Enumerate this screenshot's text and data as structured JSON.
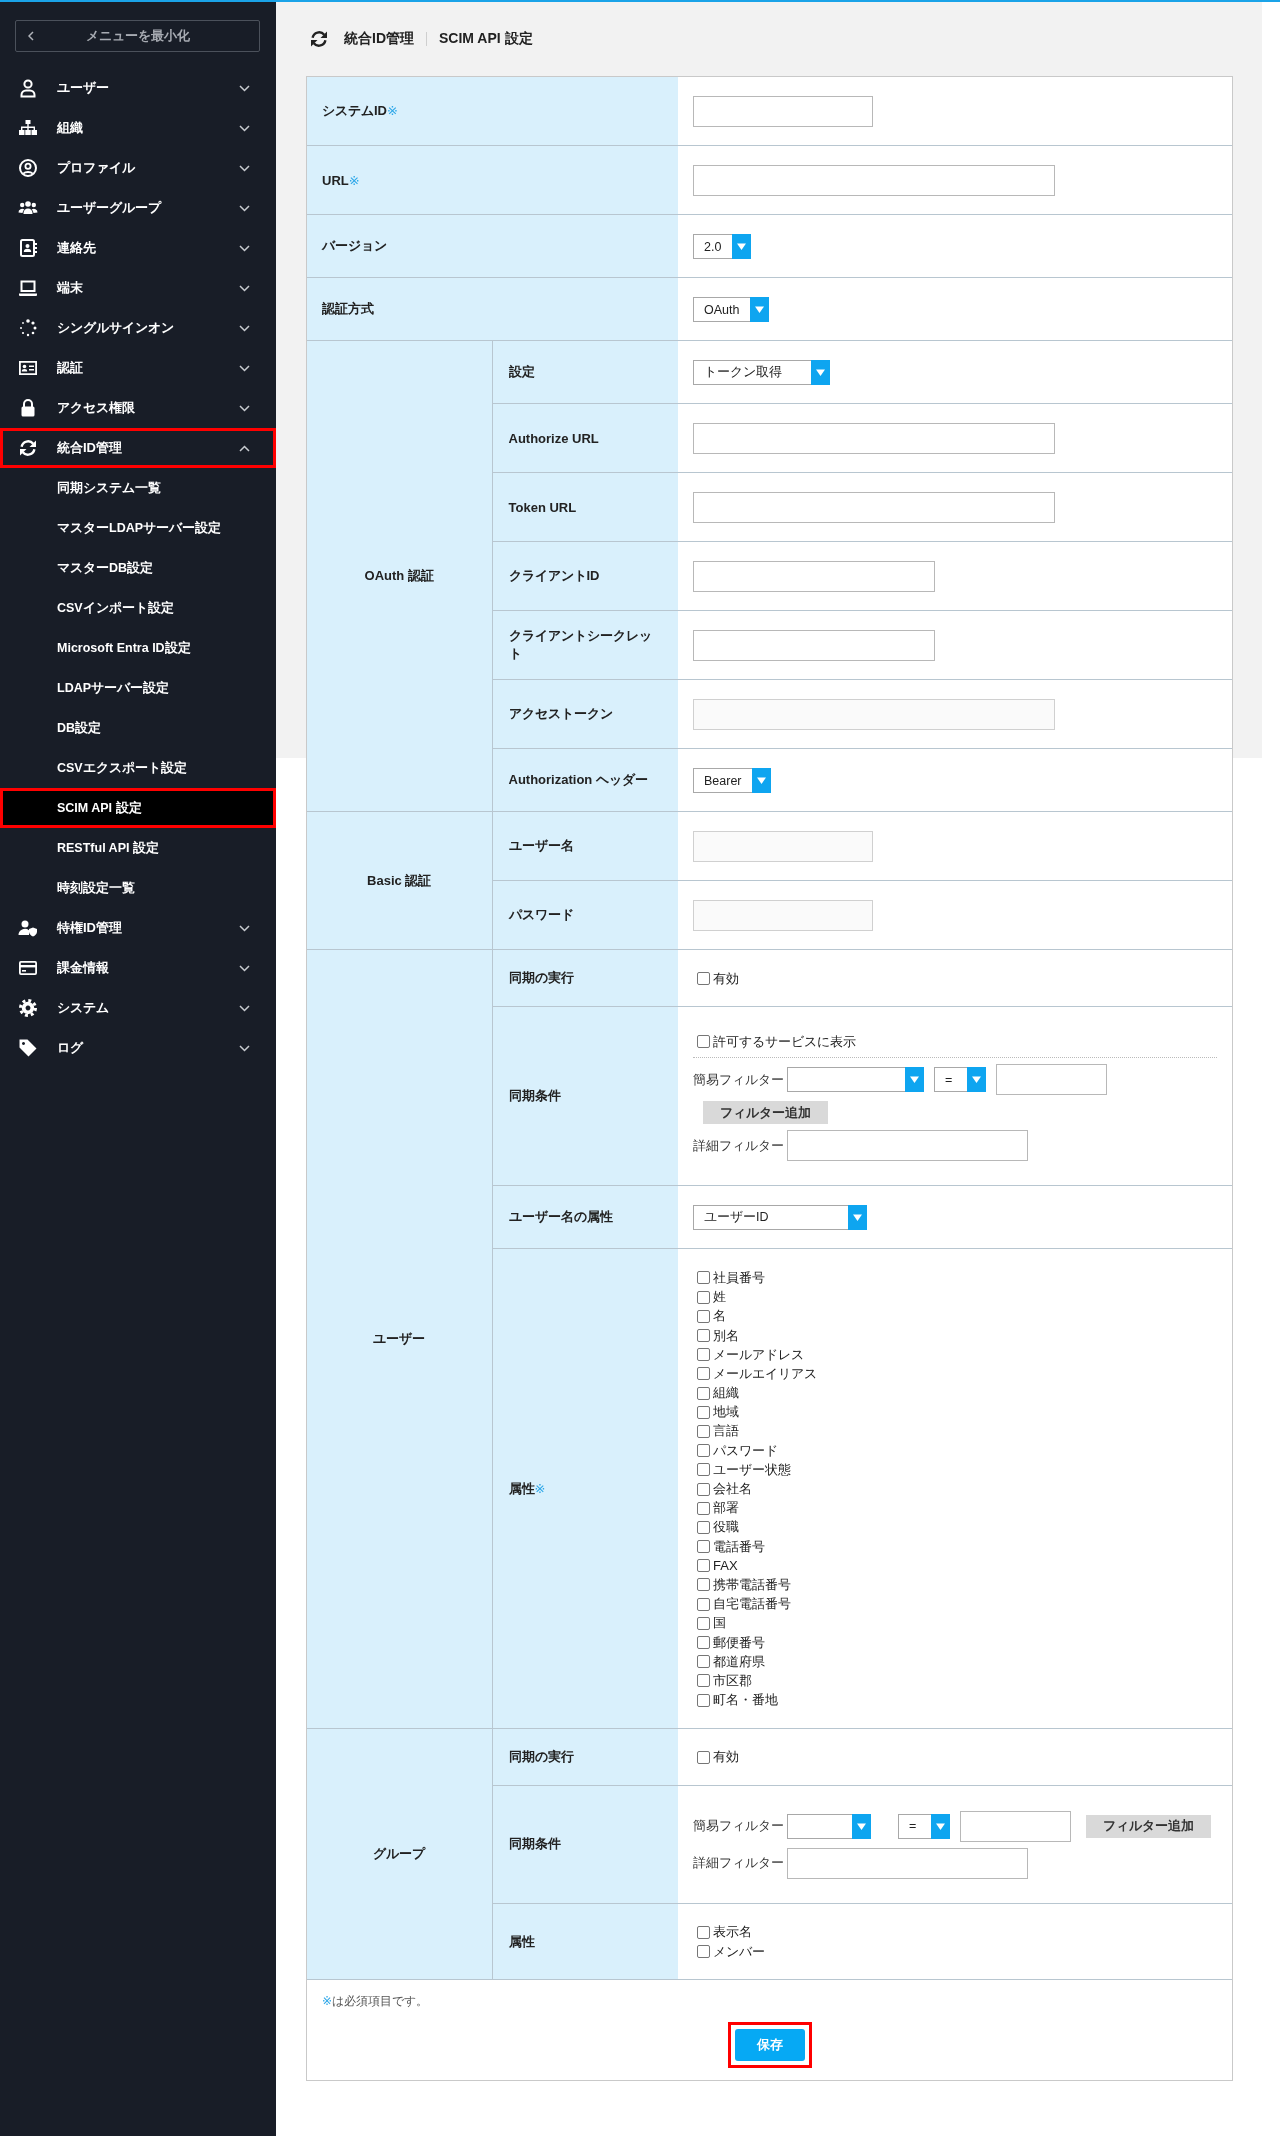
{
  "sidebar": {
    "collapse_button": {
      "label": "メニューを最小化"
    },
    "items": [
      {
        "label": "ユーザー",
        "expanded": false,
        "highlighted": false
      },
      {
        "label": "組織",
        "expanded": false,
        "highlighted": false
      },
      {
        "label": "プロファイル",
        "expanded": false,
        "highlighted": false
      },
      {
        "label": "ユーザーグループ",
        "expanded": false,
        "highlighted": false
      },
      {
        "label": "連絡先",
        "expanded": false,
        "highlighted": false
      },
      {
        "label": "端末",
        "expanded": false,
        "highlighted": false
      },
      {
        "label": "シングルサインオン",
        "expanded": false,
        "highlighted": false
      },
      {
        "label": "認証",
        "expanded": false,
        "highlighted": false
      },
      {
        "label": "アクセス権限",
        "expanded": false,
        "highlighted": false
      },
      {
        "label": "統合ID管理",
        "expanded": true,
        "highlighted": true,
        "children": [
          {
            "label": "同期システム一覧",
            "selected": false,
            "highlighted": false
          },
          {
            "label": "マスターLDAPサーバー設定",
            "selected": false,
            "highlighted": false
          },
          {
            "label": "マスターDB設定",
            "selected": false,
            "highlighted": false
          },
          {
            "label": "CSVインポート設定",
            "selected": false,
            "highlighted": false
          },
          {
            "label": "Microsoft Entra ID設定",
            "selected": false,
            "highlighted": false
          },
          {
            "label": "LDAPサーバー設定",
            "selected": false,
            "highlighted": false
          },
          {
            "label": "DB設定",
            "selected": false,
            "highlighted": false
          },
          {
            "label": "CSVエクスポート設定",
            "selected": false,
            "highlighted": false
          },
          {
            "label": "SCIM API 設定",
            "selected": true,
            "highlighted": true
          },
          {
            "label": "RESTful API 設定",
            "selected": false,
            "highlighted": false
          },
          {
            "label": "時刻設定一覧",
            "selected": false,
            "highlighted": false
          }
        ]
      },
      {
        "label": "特権ID管理",
        "expanded": false,
        "highlighted": false
      },
      {
        "label": "課金情報",
        "expanded": false,
        "highlighted": false
      },
      {
        "label": "システム",
        "expanded": false,
        "highlighted": false
      },
      {
        "label": "ログ",
        "expanded": false,
        "highlighted": false
      }
    ]
  },
  "breadcrumb": [
    {
      "label": "統合ID管理"
    },
    {
      "label": "SCIM API 設定"
    }
  ],
  "form": {
    "groups": [
      {
        "label": "システムID",
        "required_mark": "※",
        "rows": [
          {
            "lines": [
              [
                {
                  "kind": "text",
                  "disabled": false
                }
              ]
            ]
          }
        ]
      },
      {
        "label": "URL",
        "required_mark": "※",
        "rows": [
          {
            "lines": [
              [
                {
                  "kind": "text",
                  "disabled": false
                }
              ]
            ]
          }
        ]
      },
      {
        "label": "バージョン",
        "rows": [
          {
            "lines": [
              [
                {
                  "kind": "select",
                  "value": "2.0"
                }
              ]
            ]
          }
        ]
      },
      {
        "label": "認証方式",
        "rows": [
          {
            "lines": [
              [
                {
                  "kind": "select",
                  "value": "OAuth"
                }
              ]
            ]
          }
        ]
      },
      {
        "label": "OAuth 認証",
        "rows": [
          {
            "label": "設定",
            "lines": [
              [
                {
                  "kind": "select",
                  "value": "トークン取得"
                }
              ]
            ]
          },
          {
            "label": "Authorize URL",
            "lines": [
              [
                {
                  "kind": "text",
                  "disabled": false
                }
              ]
            ]
          },
          {
            "label": "Token URL",
            "lines": [
              [
                {
                  "kind": "text",
                  "disabled": false
                }
              ]
            ]
          },
          {
            "label": "クライアントID",
            "lines": [
              [
                {
                  "kind": "text",
                  "disabled": false
                }
              ]
            ]
          },
          {
            "label": "クライアントシークレット",
            "lines": [
              [
                {
                  "kind": "text",
                  "disabled": false
                }
              ]
            ]
          },
          {
            "label": "アクセストークン",
            "lines": [
              [
                {
                  "kind": "text",
                  "disabled": true
                }
              ]
            ]
          },
          {
            "label": "Authorization ヘッダー",
            "lines": [
              [
                {
                  "kind": "select",
                  "value": "Bearer"
                }
              ]
            ]
          }
        ]
      },
      {
        "label": "Basic 認証",
        "rows": [
          {
            "label": "ユーザー名",
            "lines": [
              [
                {
                  "kind": "text",
                  "disabled": true
                }
              ]
            ]
          },
          {
            "label": "パスワード",
            "lines": [
              [
                {
                  "kind": "text",
                  "disabled": true
                }
              ]
            ]
          }
        ]
      },
      {
        "label": "ユーザー",
        "rows": [
          {
            "label": "同期の実行",
            "lines": [
              [
                {
                  "kind": "checkbox",
                  "label": "有効",
                  "checked": false
                }
              ]
            ]
          },
          {
            "label": "同期条件",
            "lines": [
              [
                {
                  "kind": "checkbox",
                  "label": "許可するサービスに表示",
                  "checked": false
                }
              ],
              [
                {
                  "kind": "divider"
                }
              ],
              [
                {
                  "kind": "label",
                  "text": "簡易フィルター"
                },
                {
                  "kind": "select"
                },
                {
                  "kind": "select",
                  "value": "="
                },
                {
                  "kind": "text",
                  "disabled": false
                }
              ],
              [
                {
                  "kind": "button",
                  "label": "フィルター追加"
                }
              ],
              [
                {
                  "kind": "label",
                  "text": "詳細フィルター"
                },
                {
                  "kind": "text",
                  "disabled": false
                }
              ]
            ]
          },
          {
            "label": "ユーザー名の属性",
            "lines": [
              [
                {
                  "kind": "select",
                  "value": "ユーザーID"
                }
              ]
            ]
          },
          {
            "label": "属性",
            "required_mark": "※",
            "lines": [
              [
                {
                  "kind": "checkbox",
                  "label": "社員番号",
                  "checked": false
                }
              ],
              [
                {
                  "kind": "checkbox",
                  "label": "姓",
                  "checked": false
                }
              ],
              [
                {
                  "kind": "checkbox",
                  "label": "名",
                  "checked": false
                }
              ],
              [
                {
                  "kind": "checkbox",
                  "label": "別名",
                  "checked": false
                }
              ],
              [
                {
                  "kind": "checkbox",
                  "label": "メールアドレス",
                  "checked": false
                }
              ],
              [
                {
                  "kind": "checkbox",
                  "label": "メールエイリアス",
                  "checked": false
                }
              ],
              [
                {
                  "kind": "checkbox",
                  "label": "組織",
                  "checked": false
                }
              ],
              [
                {
                  "kind": "checkbox",
                  "label": "地域",
                  "checked": false
                }
              ],
              [
                {
                  "kind": "checkbox",
                  "label": "言語",
                  "checked": false
                }
              ],
              [
                {
                  "kind": "checkbox",
                  "label": "パスワード",
                  "checked": false
                }
              ],
              [
                {
                  "kind": "checkbox",
                  "label": "ユーザー状態",
                  "checked": false
                }
              ],
              [
                {
                  "kind": "checkbox",
                  "label": "会社名",
                  "checked": false
                }
              ],
              [
                {
                  "kind": "checkbox",
                  "label": "部署",
                  "checked": false
                }
              ],
              [
                {
                  "kind": "checkbox",
                  "label": "役職",
                  "checked": false
                }
              ],
              [
                {
                  "kind": "checkbox",
                  "label": "電話番号",
                  "checked": false
                }
              ],
              [
                {
                  "kind": "checkbox",
                  "label": "FAX",
                  "checked": false
                }
              ],
              [
                {
                  "kind": "checkbox",
                  "label": "携帯電話番号",
                  "checked": false
                }
              ],
              [
                {
                  "kind": "checkbox",
                  "label": "自宅電話番号",
                  "checked": false
                }
              ],
              [
                {
                  "kind": "checkbox",
                  "label": "国",
                  "checked": false
                }
              ],
              [
                {
                  "kind": "checkbox",
                  "label": "郵便番号",
                  "checked": false
                }
              ],
              [
                {
                  "kind": "checkbox",
                  "label": "都道府県",
                  "checked": false
                }
              ],
              [
                {
                  "kind": "checkbox",
                  "label": "市区郡",
                  "checked": false
                }
              ],
              [
                {
                  "kind": "checkbox",
                  "label": "町名・番地",
                  "checked": false
                }
              ]
            ]
          }
        ]
      },
      {
        "label": "グループ",
        "rows": [
          {
            "label": "同期の実行",
            "lines": [
              [
                {
                  "kind": "checkbox",
                  "label": "有効",
                  "checked": false
                }
              ]
            ]
          },
          {
            "label": "同期条件",
            "lines": [
              [
                {
                  "kind": "label",
                  "text": "簡易フィルター"
                },
                {
                  "kind": "select"
                },
                {
                  "kind": "select",
                  "value": "="
                },
                {
                  "kind": "text",
                  "disabled": false
                },
                {
                  "kind": "button",
                  "label": "フィルター追加"
                }
              ],
              [
                {
                  "kind": "label",
                  "text": "詳細フィルター"
                },
                {
                  "kind": "text",
                  "disabled": false
                }
              ]
            ]
          },
          {
            "label": "属性",
            "lines": [
              [
                {
                  "kind": "checkbox",
                  "label": "表示名",
                  "checked": false
                }
              ],
              [
                {
                  "kind": "checkbox",
                  "label": "メンバー",
                  "checked": false
                }
              ]
            ]
          }
        ]
      }
    ]
  },
  "footer": {
    "note_mark": "※",
    "note": "は必須項目です。"
  },
  "save_button": {
    "label": "保存",
    "highlighted": true
  }
}
